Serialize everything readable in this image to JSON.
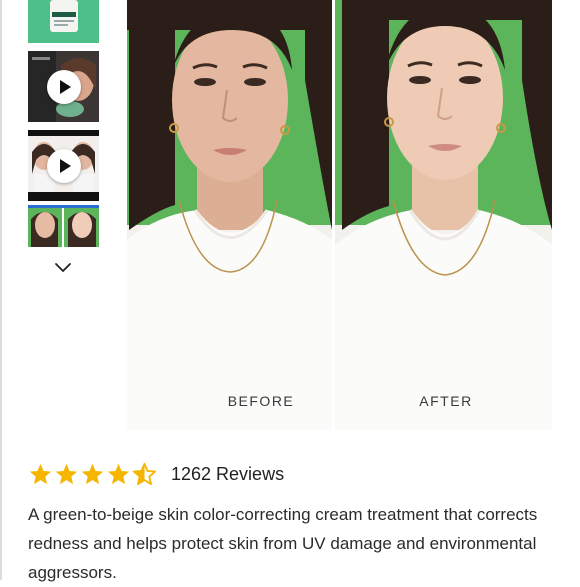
{
  "gallery": {
    "thumbnails": [
      {
        "id": "thumb-product",
        "icon": "none"
      },
      {
        "id": "thumb-video-1",
        "icon": "play-icon"
      },
      {
        "id": "thumb-video-2",
        "icon": "play-icon"
      },
      {
        "id": "thumb-faces",
        "icon": "none"
      }
    ],
    "more_icon": "chevron-down-icon",
    "main": {
      "before_label": "BEFORE",
      "after_label": "AFTER",
      "background_color": "#5cb55b"
    }
  },
  "product": {
    "rating": {
      "value": 4.5,
      "max": 5,
      "star_color": "#f6b500",
      "count_text": "1262 Reviews"
    },
    "description": "A green-to-beige skin color-correcting cream treatment that corrects redness and helps protect skin from UV damage and environmental aggressors."
  }
}
